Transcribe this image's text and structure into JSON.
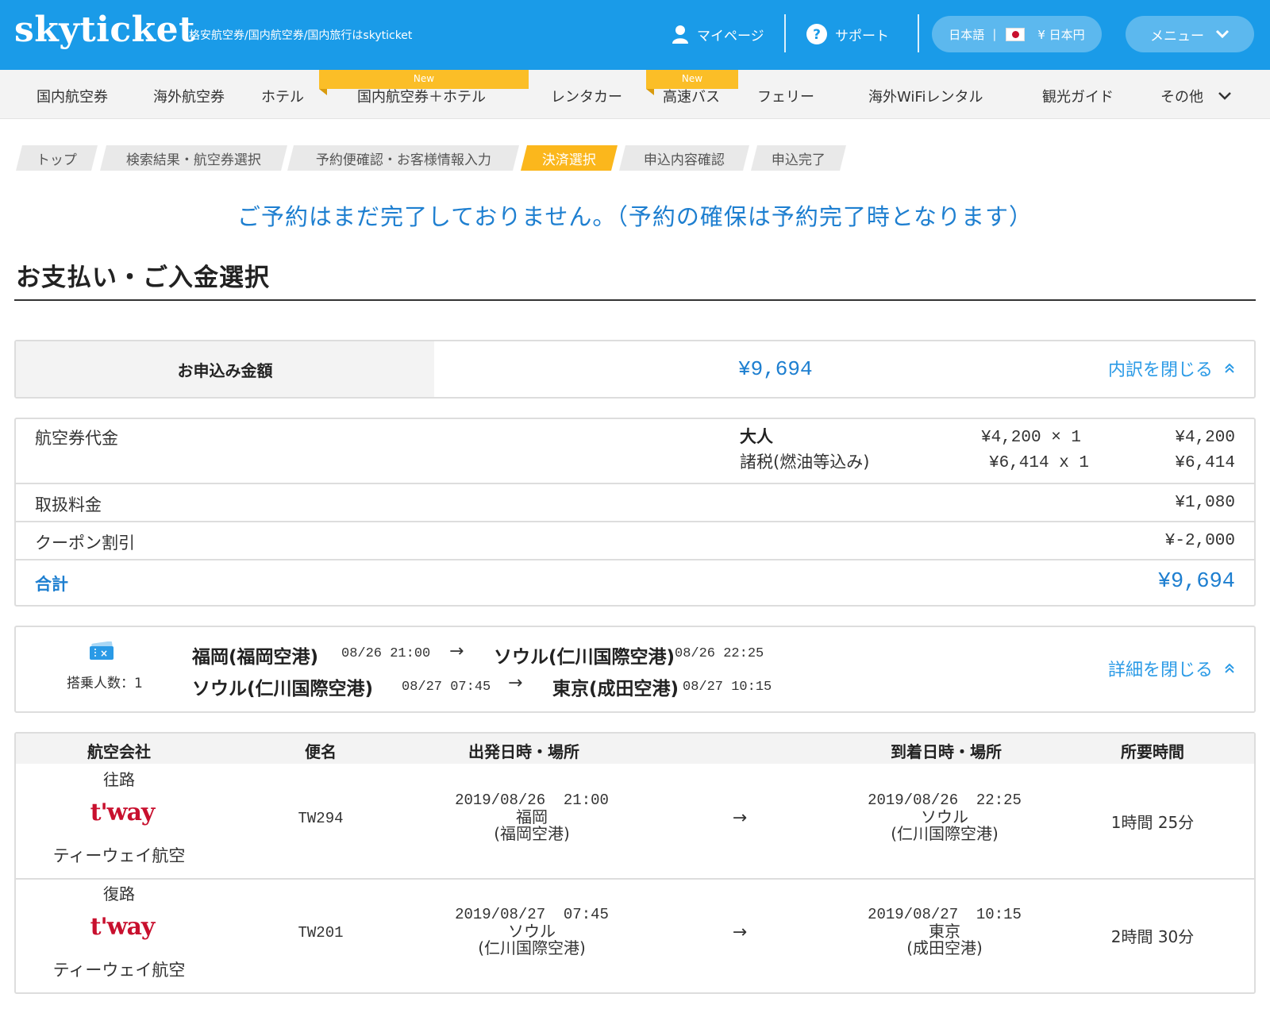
{
  "header": {
    "logo": "skyticket",
    "tagline": "格安航空券/国内航空券/国内旅行はskyticket",
    "mypage": "マイページ",
    "support": "サポート",
    "language": "日本語",
    "language_sep": "|",
    "currency": "¥ 日本円",
    "menu": "メニュー"
  },
  "nav": {
    "new_badge": "New",
    "items": [
      "国内航空券",
      "海外航空券",
      "ホテル",
      "国内航空券＋ホテル",
      "レンタカー",
      "高速バス",
      "フェリー",
      "海外WiFiレンタル",
      "観光ガイド",
      "その他"
    ]
  },
  "breadcrumb": [
    "トップ",
    "検索結果・航空券選択",
    "予約便確認・お客様情報入力",
    "決済選択",
    "申込内容確認",
    "申込完了"
  ],
  "notice": "ご予約はまだ完了しておりません。（予約の確保は予約完了時となります）",
  "page_title": "お支払い・ご入金選択",
  "amount": {
    "label": "お申込み金額",
    "value": "¥9,694",
    "toggle": "内訳を閉じる"
  },
  "breakdown": {
    "fare_label": "航空券代金",
    "adult_label": "大人",
    "tax_label": "諸税(燃油等込み)",
    "adult_unit": "¥4,200 × 1",
    "tax_unit": "¥6,414 x 1",
    "adult_total": "¥4,200",
    "tax_total": "¥6,414",
    "handling_label": "取扱料金",
    "handling_value": "¥1,080",
    "coupon_label": "クーポン割引",
    "coupon_value": "¥-2,000",
    "total_label": "合計",
    "total_value": "¥9,694"
  },
  "route": {
    "pax": "搭乗人数：1",
    "toggle": "詳細を閉じる",
    "arrow": "→",
    "legs": [
      {
        "from": "福岡(福岡空港)",
        "dep": "08/26 21:00",
        "to": "ソウル(仁川国際空港)",
        "arr": "08/26 22:25"
      },
      {
        "from": "ソウル(仁川国際空港)",
        "dep": "08/27 07:45",
        "to": "東京(成田空港)",
        "arr": "08/27 10:15"
      }
    ]
  },
  "flights": {
    "headers": [
      "航空会社",
      "便名",
      "出発日時・場所",
      "到着日時・場所",
      "所要時間"
    ],
    "arrow": "→",
    "rows": [
      {
        "direction": "往路",
        "logo_text": "t'way",
        "airline": "ティーウェイ航空",
        "flight_no": "TW294",
        "dep_datetime": "2019/08/26  21:00",
        "dep_city": "福岡",
        "dep_airport": "(福岡空港)",
        "arr_datetime": "2019/08/26  22:25",
        "arr_city": "ソウル",
        "arr_airport": "(仁川国際空港)",
        "duration": "1時間 25分"
      },
      {
        "direction": "復路",
        "logo_text": "t'way",
        "airline": "ティーウェイ航空",
        "flight_no": "TW201",
        "dep_datetime": "2019/08/27  07:45",
        "dep_city": "ソウル",
        "dep_airport": "(仁川国際空港)",
        "arr_datetime": "2019/08/27  10:15",
        "arr_city": "東京",
        "arr_airport": "(成田空港)",
        "duration": "2時間 30分"
      }
    ]
  }
}
